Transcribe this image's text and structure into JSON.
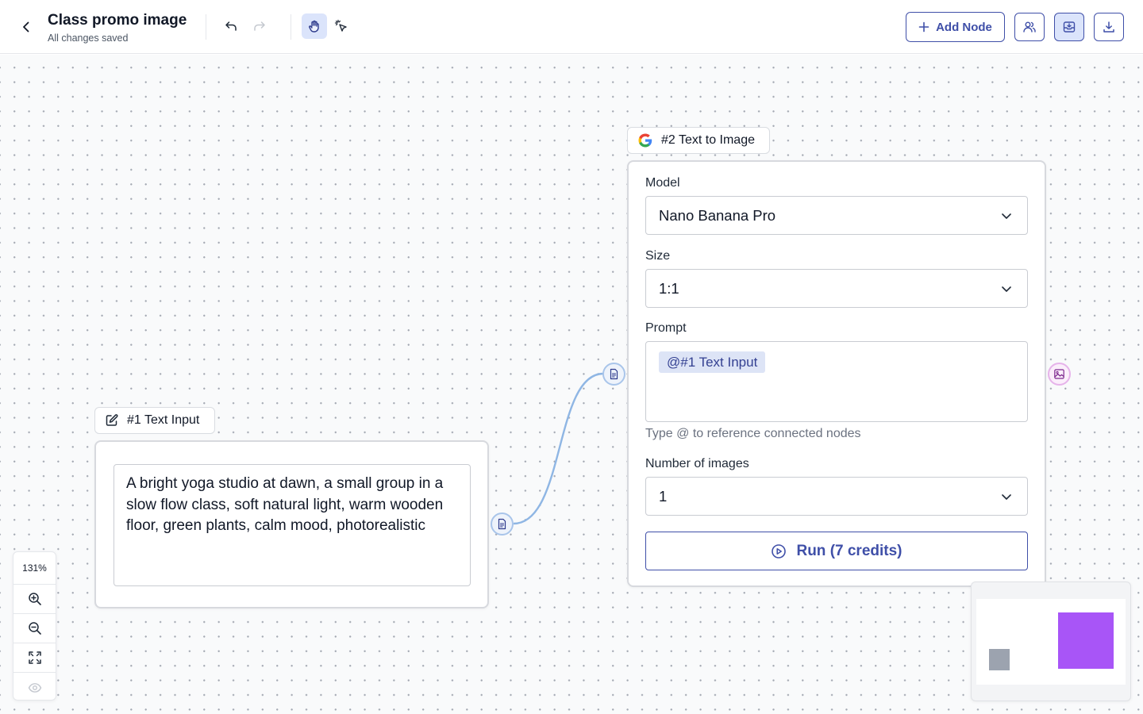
{
  "header": {
    "title": "Class promo image",
    "status": "All changes saved",
    "add_node_label": "Add Node"
  },
  "nodes": {
    "text_input": {
      "label": "#1 Text Input",
      "text": "A bright yoga studio at dawn, a small group in a slow flow class, soft natural light, warm wooden floor, green plants, calm mood, photorealistic"
    },
    "text_to_image": {
      "label": "#2 Text to Image",
      "model_label": "Model",
      "model_value": "Nano Banana Pro",
      "size_label": "Size",
      "size_value": "1:1",
      "prompt_label": "Prompt",
      "prompt_mention": "@#1 Text Input",
      "prompt_helper": "Type @ to reference connected nodes",
      "num_images_label": "Number of images",
      "num_images_value": "1",
      "run_label": "Run (7 credits)"
    }
  },
  "zoom": {
    "level": "131%"
  },
  "colors": {
    "accent": "#3f4fa8",
    "active_bg": "#dbe4fb",
    "edge": "#8fb6e4",
    "minimap_text_node": "#9ca3af",
    "minimap_image_node": "#a855f7"
  },
  "icons": {
    "back": "chevron-left-icon",
    "undo": "undo-icon",
    "redo": "redo-icon",
    "pan_tool": "hand-icon",
    "select_tool": "cursor-click-icon",
    "add": "plus-icon",
    "share": "users-icon",
    "save": "tray-download-icon",
    "export": "download-icon",
    "text_node": "edit-icon",
    "image_node": "google-icon",
    "zoom_in": "zoom-in-icon",
    "zoom_out": "zoom-out-icon",
    "fit": "fit-view-icon",
    "visibility": "eye-icon"
  }
}
